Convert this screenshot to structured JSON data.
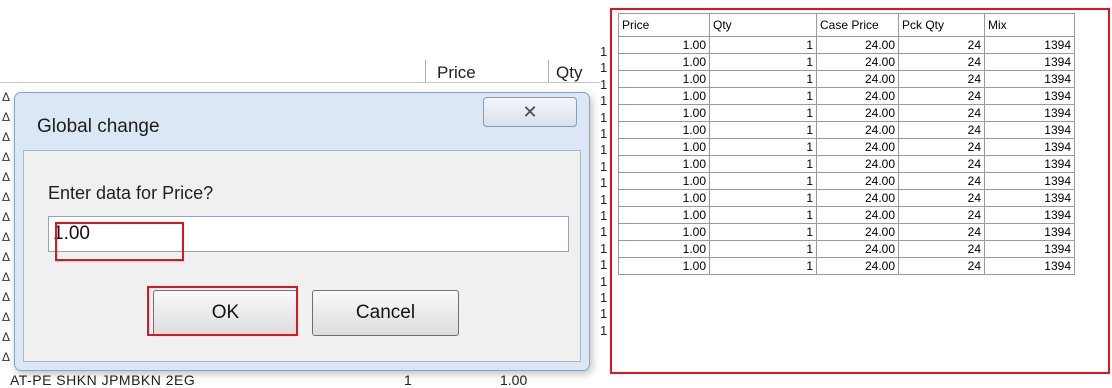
{
  "background_grid": {
    "headers": {
      "price": "Price",
      "qty": "Qty"
    },
    "row_index_marks": [
      "1",
      "1",
      "1",
      "1",
      "1",
      "1",
      "1",
      "1",
      "1",
      "1",
      "1",
      "1",
      "1",
      "1"
    ],
    "row_glyph": "Δ",
    "bottom_row": {
      "description": "AT-PE SHKN JPMBKN 2EG",
      "qty": "1",
      "price": "1.00"
    }
  },
  "dialog": {
    "title": "Global change",
    "prompt": "Enter data for Price?",
    "input_value": "1.00",
    "ok_label": "OK",
    "cancel_label": "Cancel",
    "close_glyph": "✕"
  },
  "table": {
    "columns": [
      "Price",
      "Qty",
      "Case Price",
      "Pck Qty",
      "Mix"
    ],
    "rows": [
      [
        "1.00",
        "1",
        "24.00",
        "24",
        "1394"
      ],
      [
        "1.00",
        "1",
        "24.00",
        "24",
        "1394"
      ],
      [
        "1.00",
        "1",
        "24.00",
        "24",
        "1394"
      ],
      [
        "1.00",
        "1",
        "24.00",
        "24",
        "1394"
      ],
      [
        "1.00",
        "1",
        "24.00",
        "24",
        "1394"
      ],
      [
        "1.00",
        "1",
        "24.00",
        "24",
        "1394"
      ],
      [
        "1.00",
        "1",
        "24.00",
        "24",
        "1394"
      ],
      [
        "1.00",
        "1",
        "24.00",
        "24",
        "1394"
      ],
      [
        "1.00",
        "1",
        "24.00",
        "24",
        "1394"
      ],
      [
        "1.00",
        "1",
        "24.00",
        "24",
        "1394"
      ],
      [
        "1.00",
        "1",
        "24.00",
        "24",
        "1394"
      ],
      [
        "1.00",
        "1",
        "24.00",
        "24",
        "1394"
      ],
      [
        "1.00",
        "1",
        "24.00",
        "24",
        "1394"
      ],
      [
        "1.00",
        "1",
        "24.00",
        "24",
        "1394"
      ]
    ],
    "left_row_marks": [
      "1",
      "1",
      "1",
      "1",
      "1",
      "1",
      "1",
      "1",
      "1",
      "1",
      "1",
      "1",
      "1",
      "1",
      "1",
      "1",
      "1",
      "1"
    ]
  },
  "colors": {
    "highlight": "#e0141e",
    "dialog_frame": "#dbe7f4",
    "dialog_body": "#f0f0f0"
  }
}
